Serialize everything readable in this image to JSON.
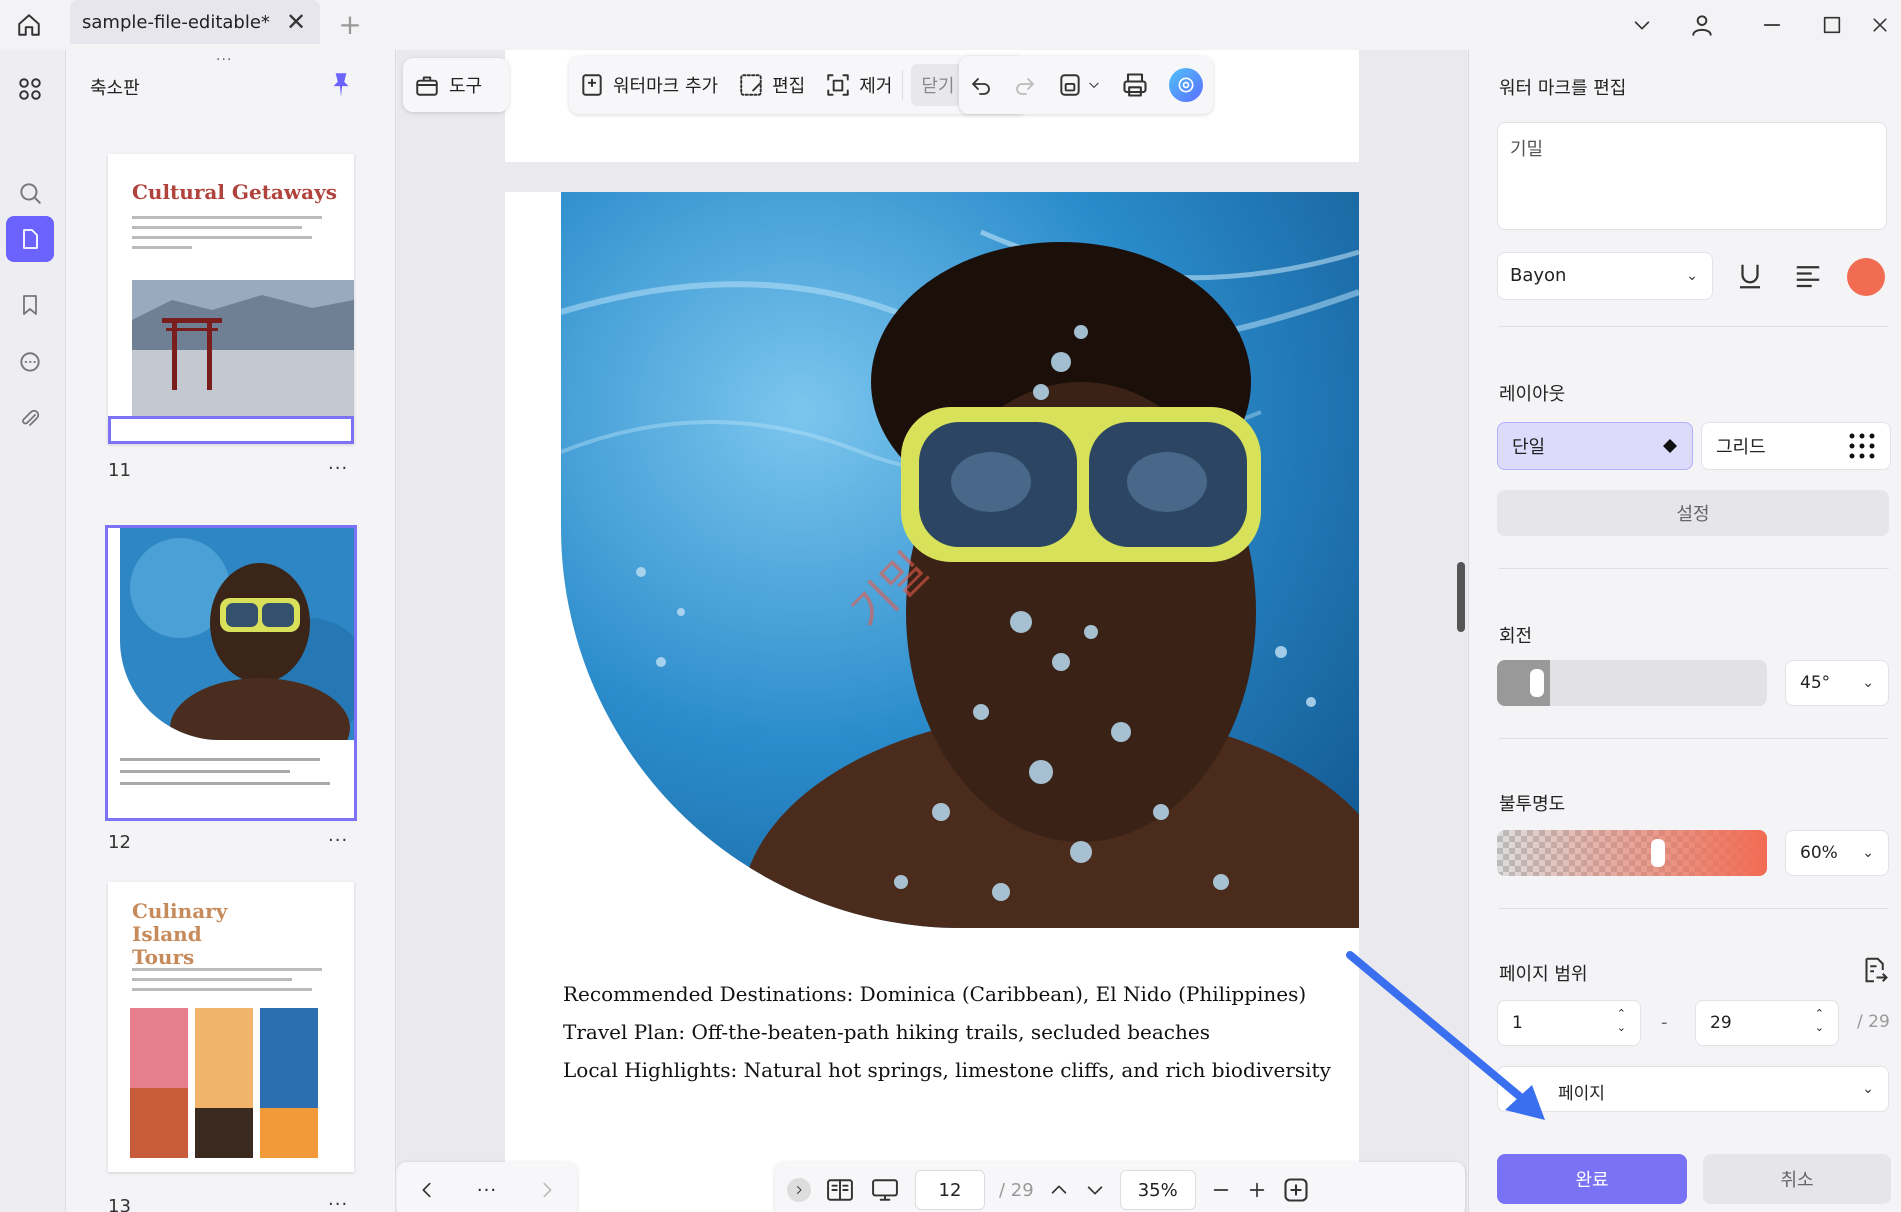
{
  "titlebar": {
    "tab_title": "sample-file-editable*",
    "close_glyph": "✕",
    "new_tab_glyph": "+"
  },
  "thumbnails": {
    "title": "축소판",
    "items": [
      {
        "page": "11",
        "heading": "Cultural Getaways"
      },
      {
        "page": "12",
        "heading": ""
      },
      {
        "page": "13",
        "heading": "Culinary Island Tours"
      }
    ],
    "more_glyph": "···"
  },
  "toolbar": {
    "tools_label": "도구",
    "add_watermark": "워터마크 추가",
    "edit": "편집",
    "remove": "제거",
    "close": "닫기"
  },
  "document": {
    "watermark_text": "기밀",
    "lines": [
      "Recommended Destinations: Dominica (Caribbean), El Nido (Philippines)",
      "Travel Plan: Off-the-beaten-path hiking trails, secluded beaches",
      "Local Highlights: Natural hot springs, limestone cliffs, and rich biodiversity"
    ]
  },
  "bottom_bar": {
    "current_page": "12",
    "total_pages": "/ 29",
    "zoom": "35%",
    "more_glyph": "···"
  },
  "right_panel": {
    "title": "워터 마크를 편집",
    "text_value": "기밀",
    "font": "Bayon",
    "color": "#f26b53",
    "layout_label": "레이아웃",
    "layout_single": "단일",
    "layout_grid": "그리드",
    "settings_button": "설정",
    "rotation_label": "회전",
    "rotation_value": "45°",
    "rotation_level": 0.05,
    "opacity_label": "불투명도",
    "opacity_value": "60%",
    "opacity_level": 0.6,
    "page_range_label": "페이지 범위",
    "range_from": "1",
    "range_dash": "-",
    "range_to": "29",
    "range_total": "/ 29",
    "page_subset": "페이지",
    "confirm_button": "완료",
    "cancel_button": "취소"
  }
}
